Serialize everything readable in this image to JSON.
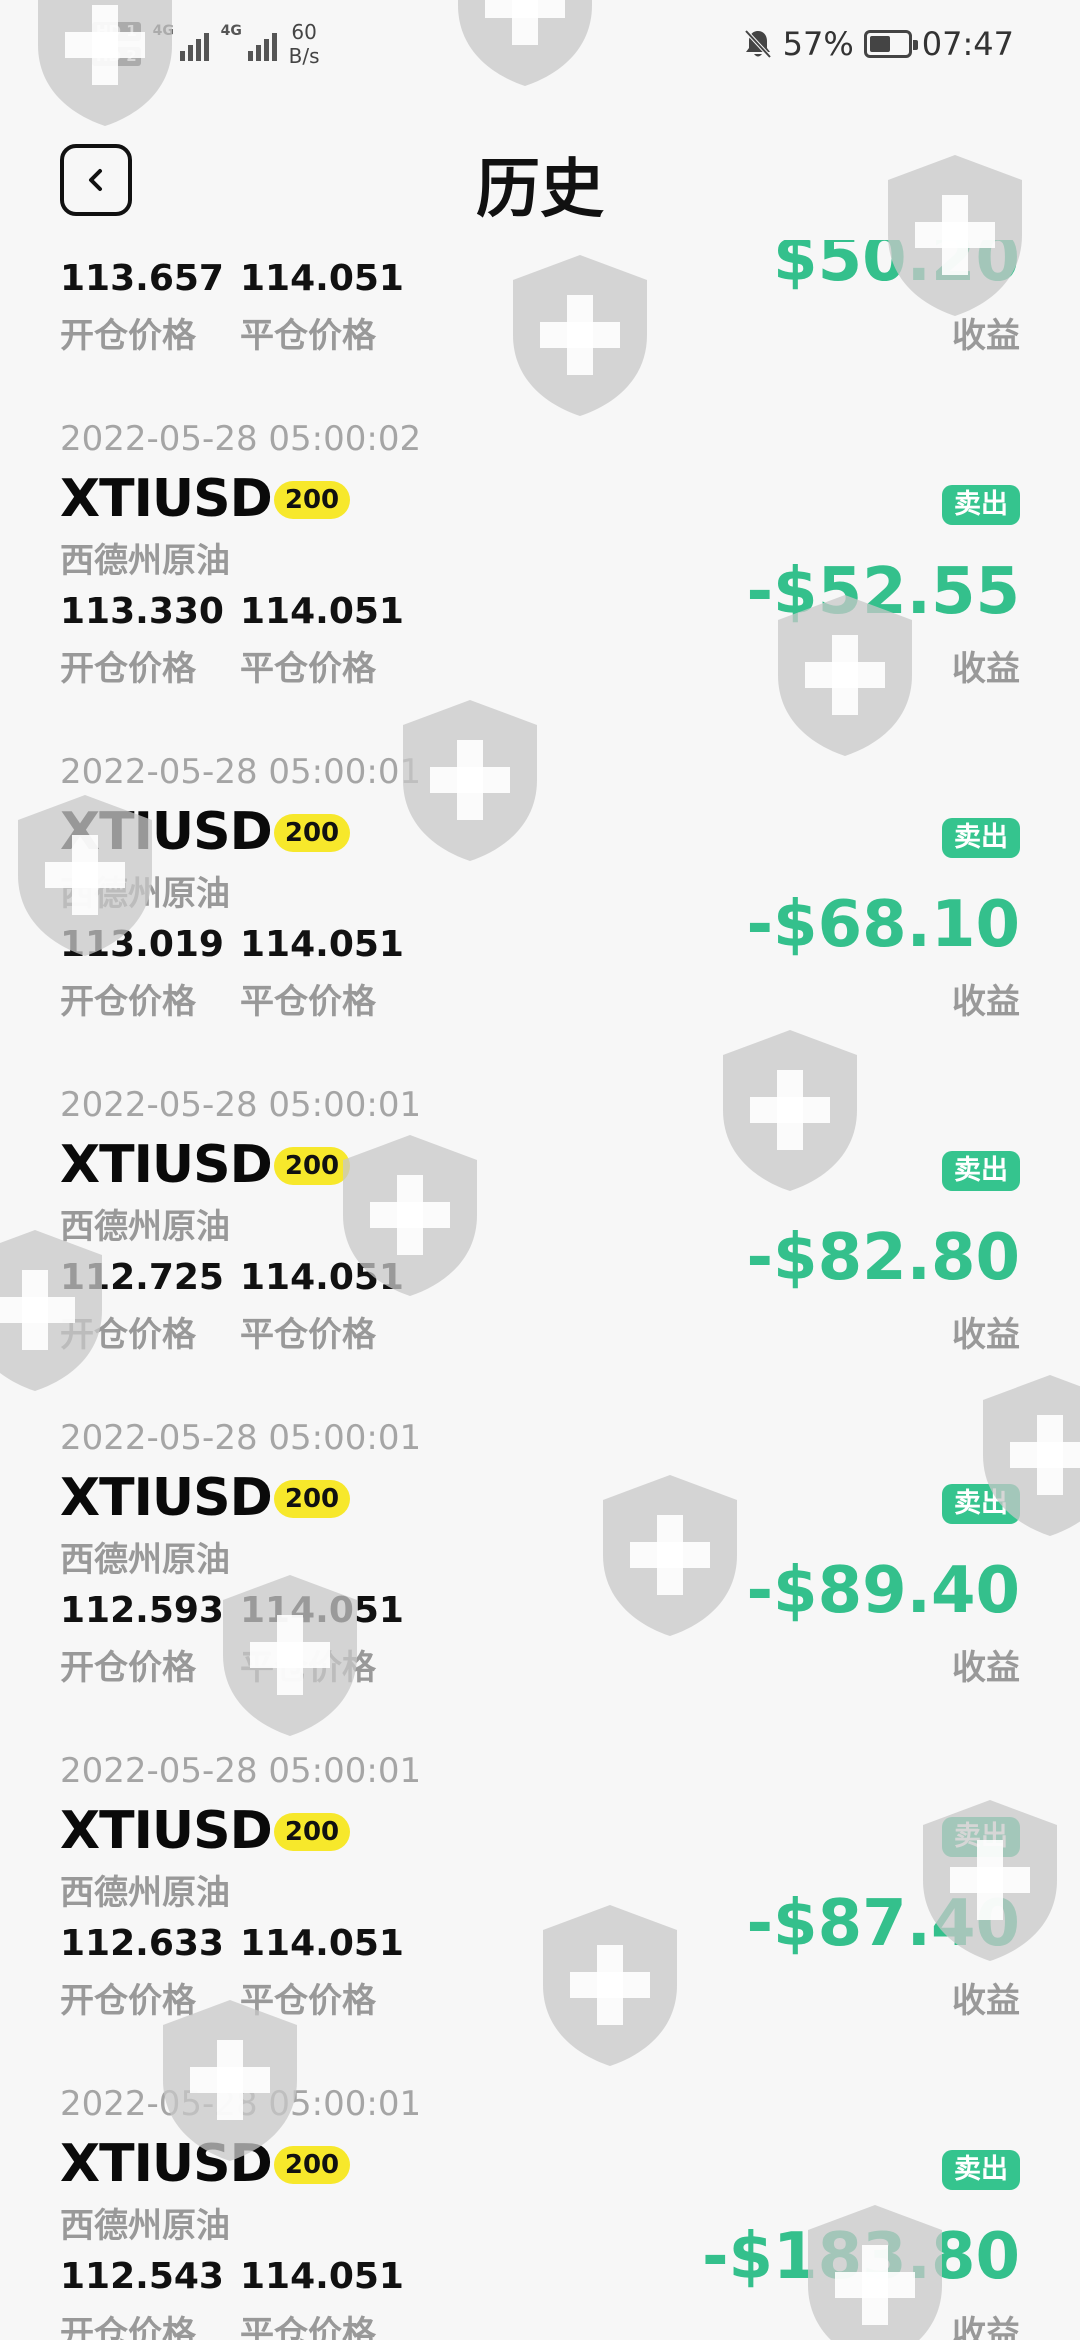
{
  "status": {
    "sim1": "HD 1",
    "sim2": "HD 2",
    "network": "4G",
    "speed_value": "60",
    "speed_unit": "B/s",
    "battery": "57%",
    "time": "07:47"
  },
  "header": {
    "title": "历史"
  },
  "labels": {
    "open_price": "开仓价格",
    "close_price": "平仓价格",
    "profit": "收益"
  },
  "orders": [
    {
      "time": "",
      "symbol": "",
      "qty": "",
      "name": "",
      "open": "113.657",
      "close": "114.051",
      "side": "",
      "profit": "$50.20"
    },
    {
      "time": "2022-05-28 05:00:02",
      "symbol": "XTIUSD",
      "qty": "200",
      "name": "西德州原油",
      "open": "113.330",
      "close": "114.051",
      "side": "卖出",
      "profit": "-$52.55"
    },
    {
      "time": "2022-05-28 05:00:01",
      "symbol": "XTIUSD",
      "qty": "200",
      "name": "西德州原油",
      "open": "113.019",
      "close": "114.051",
      "side": "卖出",
      "profit": "-$68.10"
    },
    {
      "time": "2022-05-28 05:00:01",
      "symbol": "XTIUSD",
      "qty": "200",
      "name": "西德州原油",
      "open": "112.725",
      "close": "114.051",
      "side": "卖出",
      "profit": "-$82.80"
    },
    {
      "time": "2022-05-28 05:00:01",
      "symbol": "XTIUSD",
      "qty": "200",
      "name": "西德州原油",
      "open": "112.593",
      "close": "114.051",
      "side": "卖出",
      "profit": "-$89.40"
    },
    {
      "time": "2022-05-28 05:00:01",
      "symbol": "XTIUSD",
      "qty": "200",
      "name": "西德州原油",
      "open": "112.633",
      "close": "114.051",
      "side": "卖出",
      "profit": "-$87.40"
    },
    {
      "time": "2022-05-28 05:00:01",
      "symbol": "XTIUSD",
      "qty": "200",
      "name": "西德州原油",
      "open": "112.543",
      "close": "114.051",
      "side": "卖出",
      "profit": "-$183.80"
    }
  ],
  "colors": {
    "profit": "#34c08c",
    "side_badge": "#35c48e",
    "qty_badge": "#f7e82b",
    "watermark": "#c8c8c8"
  },
  "icons": {
    "back": "chevron-left-icon",
    "watermark": "shield-cross-icon",
    "mute": "bell-off-icon"
  }
}
